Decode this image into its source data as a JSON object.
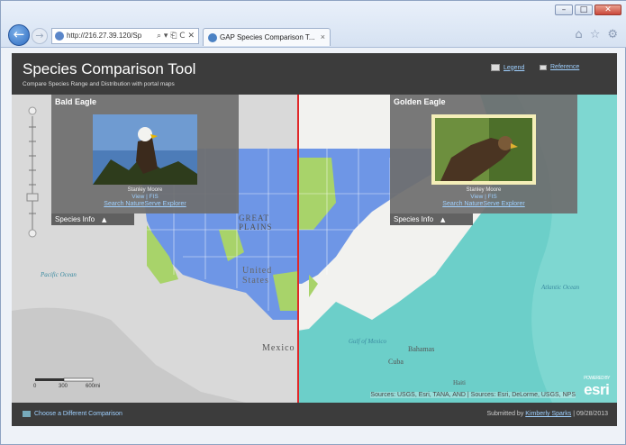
{
  "browser": {
    "address": "http://216.27.39.120/Sp",
    "address_controls": "⌕ ▾ ⎗ C ✕",
    "tab_title": "GAP Species Comparison T...",
    "tab_close": "×",
    "window_min": "–",
    "window_max": "□",
    "window_close": "✕",
    "back": "←",
    "forward": "→",
    "toolbar_icons": [
      "⌂",
      "☆",
      "⚙"
    ]
  },
  "app": {
    "title": "Species Comparison Tool",
    "subtitle": "Compare Species Range and Distribution with portal maps",
    "header_links": [
      {
        "label": "Legend",
        "icon": "legend-icon"
      },
      {
        "label": "Reference",
        "icon": "reference-icon"
      }
    ],
    "footer": {
      "left_label": "Choose a Different Comparison",
      "right_prefix": "Submitted by ",
      "right_link": "Kimberly Sparks",
      "right_suffix": " | 09/28/2013"
    }
  },
  "panels": [
    {
      "name": "Bald Eagle",
      "credit": "Stanley Moore",
      "view_link": "View | FIS",
      "ns_link": "Search NatureServe Explorer",
      "info_tab": "Species Info",
      "info_arrow": "▲"
    },
    {
      "name": "Golden Eagle",
      "credit": "Stanley Moore",
      "view_link": "View | FIS",
      "ns_link": "Search NatureServe Explorer",
      "info_tab": "Species Info",
      "info_arrow": "▲"
    }
  ],
  "map": {
    "labels": {
      "great_plains": "GREAT\nPLAINS",
      "united_states": "United\nStates",
      "mexico": "Mexico",
      "pacific": "Pacific Ocean",
      "atlantic": "Atlantic Ocean",
      "gulf": "Gulf of Mexico",
      "bahamas": "Bahamas",
      "cuba": "Cuba",
      "haiti": "Haiti"
    },
    "scale": {
      "ticks": [
        "0",
        "300",
        "600mi"
      ]
    },
    "attribution": "Sources: USGS, Esri, TANA, AND | Sources: Esri, DeLorme, USGS, NPS",
    "logo": "esri",
    "logo_small": "POWERED BY",
    "colors": {
      "range": "#6e96e6",
      "distribution": "#a8d36a",
      "divider": "#e0282a",
      "land": "#dcdcdc",
      "ocean": "#6ccfc9"
    }
  }
}
